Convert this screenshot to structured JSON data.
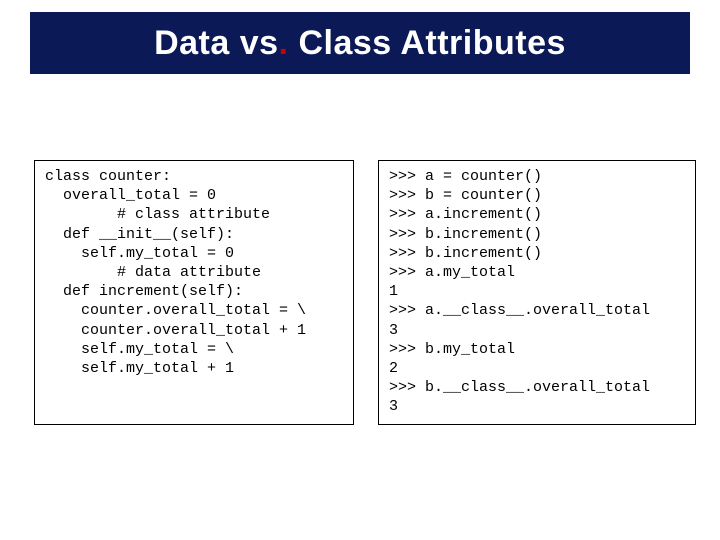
{
  "title": {
    "part1": "Data vs",
    "sep": ".",
    "part2": " Class Attributes"
  },
  "left_code": "class counter:\n  overall_total = 0\n        # class attribute\n  def __init__(self):\n    self.my_total = 0\n        # data attribute\n  def increment(self):\n    counter.overall_total = \\\n    counter.overall_total + 1\n    self.my_total = \\\n    self.my_total + 1",
  "right_code": ">>> a = counter()\n>>> b = counter()\n>>> a.increment()\n>>> b.increment()\n>>> b.increment()\n>>> a.my_total\n1\n>>> a.__class__.overall_total\n3\n>>> b.my_total\n2\n>>> b.__class__.overall_total\n3"
}
